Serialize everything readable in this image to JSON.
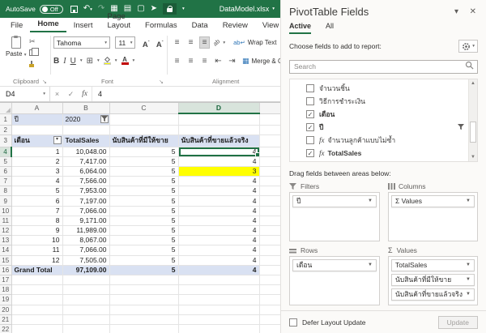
{
  "titlebar": {
    "autosave_label": "AutoSave",
    "autosave_state": "Off",
    "filename": "DataModel.xlsx",
    "icons": [
      "save-icon",
      "undo-icon",
      "redo-icon",
      "table-icon",
      "form-icon",
      "page-icon",
      "pointer-icon",
      "lock-icon",
      "customize-chevron-icon"
    ]
  },
  "ribbon": {
    "tabs": [
      "File",
      "Home",
      "Insert",
      "Page Layout",
      "Formulas",
      "Data",
      "Review",
      "View"
    ],
    "active_tab": "Home",
    "paste_label": "Paste",
    "font_name": "Tahoma",
    "font_size": "11",
    "wrap_text_label": "Wrap Text",
    "merge_center_label": "Merge & Center",
    "groups": [
      "Clipboard",
      "Font",
      "Alignment"
    ]
  },
  "formula_bar": {
    "name_box": "D4",
    "value": "4"
  },
  "sheet": {
    "column_headers": [
      "A",
      "B",
      "C",
      "D"
    ],
    "selected_column": "D",
    "selected_row": "4",
    "active_cell": "D4",
    "highlighted_cell": {
      "row": "6",
      "column": "D",
      "color": "#FFFF00"
    },
    "fill_colors": {
      "pivot_blue": "#D9E1F2",
      "highlight_yellow": "#FFFF00",
      "selection_green": "#217346"
    },
    "rows": [
      {
        "n": "1",
        "type": "filter",
        "cells": [
          "ปี",
          "2020",
          "",
          ""
        ]
      },
      {
        "n": "2",
        "type": "blank",
        "cells": [
          "",
          "",
          "",
          ""
        ]
      },
      {
        "n": "3",
        "type": "header",
        "cells": [
          "เดือน",
          "TotalSales",
          "นับสินค้าที่มีให้ขาย",
          "นับสินค้าที่ขายแล้วจริง"
        ]
      },
      {
        "n": "4",
        "type": "data",
        "cells": [
          "1",
          "10,048.00",
          "5",
          "4"
        ]
      },
      {
        "n": "5",
        "type": "data",
        "cells": [
          "2",
          "7,417.00",
          "5",
          "4"
        ]
      },
      {
        "n": "6",
        "type": "data",
        "cells": [
          "3",
          "6,064.00",
          "5",
          "3"
        ]
      },
      {
        "n": "7",
        "type": "data",
        "cells": [
          "4",
          "7,566.00",
          "5",
          "4"
        ]
      },
      {
        "n": "8",
        "type": "data",
        "cells": [
          "5",
          "7,953.00",
          "5",
          "4"
        ]
      },
      {
        "n": "9",
        "type": "data",
        "cells": [
          "6",
          "7,197.00",
          "5",
          "4"
        ]
      },
      {
        "n": "10",
        "type": "data",
        "cells": [
          "7",
          "7,066.00",
          "5",
          "4"
        ]
      },
      {
        "n": "11",
        "type": "data",
        "cells": [
          "8",
          "9,171.00",
          "5",
          "4"
        ]
      },
      {
        "n": "12",
        "type": "data",
        "cells": [
          "9",
          "11,989.00",
          "5",
          "4"
        ]
      },
      {
        "n": "13",
        "type": "data",
        "cells": [
          "10",
          "8,067.00",
          "5",
          "4"
        ]
      },
      {
        "n": "14",
        "type": "data",
        "cells": [
          "11",
          "7,066.00",
          "5",
          "4"
        ]
      },
      {
        "n": "15",
        "type": "data",
        "cells": [
          "12",
          "7,505.00",
          "5",
          "4"
        ]
      },
      {
        "n": "16",
        "type": "total",
        "cells": [
          "Grand Total",
          "97,109.00",
          "5",
          "4"
        ]
      },
      {
        "n": "17",
        "type": "blank",
        "cells": [
          "",
          "",
          "",
          ""
        ]
      },
      {
        "n": "18",
        "type": "blank",
        "cells": [
          "",
          "",
          "",
          ""
        ]
      },
      {
        "n": "19",
        "type": "blank",
        "cells": [
          "",
          "",
          "",
          ""
        ]
      },
      {
        "n": "20",
        "type": "blank",
        "cells": [
          "",
          "",
          "",
          ""
        ]
      },
      {
        "n": "21",
        "type": "blank",
        "cells": [
          "",
          "",
          "",
          ""
        ]
      },
      {
        "n": "22",
        "type": "blank",
        "cells": [
          "",
          "",
          "",
          ""
        ]
      }
    ]
  },
  "pivot_panel": {
    "title": "PivotTable Fields",
    "tabs": [
      "Active",
      "All"
    ],
    "active_tab": "Active",
    "choose_label": "Choose fields to add to report:",
    "search_placeholder": "Search",
    "fields": [
      {
        "label": "จำนวนชิ้น",
        "checked": false,
        "fx": false
      },
      {
        "label": "วิธีการชำระเงิน",
        "checked": false,
        "fx": false
      },
      {
        "label": "เดือน",
        "checked": true,
        "fx": false
      },
      {
        "label": "ปี",
        "checked": true,
        "fx": false,
        "filtered": true
      },
      {
        "label": "จำนวนลูกค้าแบบไม่ซ้ำ",
        "checked": false,
        "fx": true
      },
      {
        "label": "TotalSales",
        "checked": true,
        "fx": true
      }
    ],
    "drag_label": "Drag fields between areas below:",
    "areas": {
      "filters": {
        "label": "Filters",
        "items": [
          "ปี"
        ]
      },
      "columns": {
        "label": "Columns",
        "items": [
          "Σ Values"
        ]
      },
      "rows": {
        "label": "Rows",
        "items": [
          "เดือน"
        ]
      },
      "values": {
        "label": "Values",
        "items": [
          "TotalSales",
          "นับสินค้าที่มีให้ขาย",
          "นับสินค้าที่ขายแล้วจริง"
        ]
      }
    },
    "defer_label": "Defer Layout Update",
    "update_label": "Update",
    "accent_green": "#217346"
  }
}
